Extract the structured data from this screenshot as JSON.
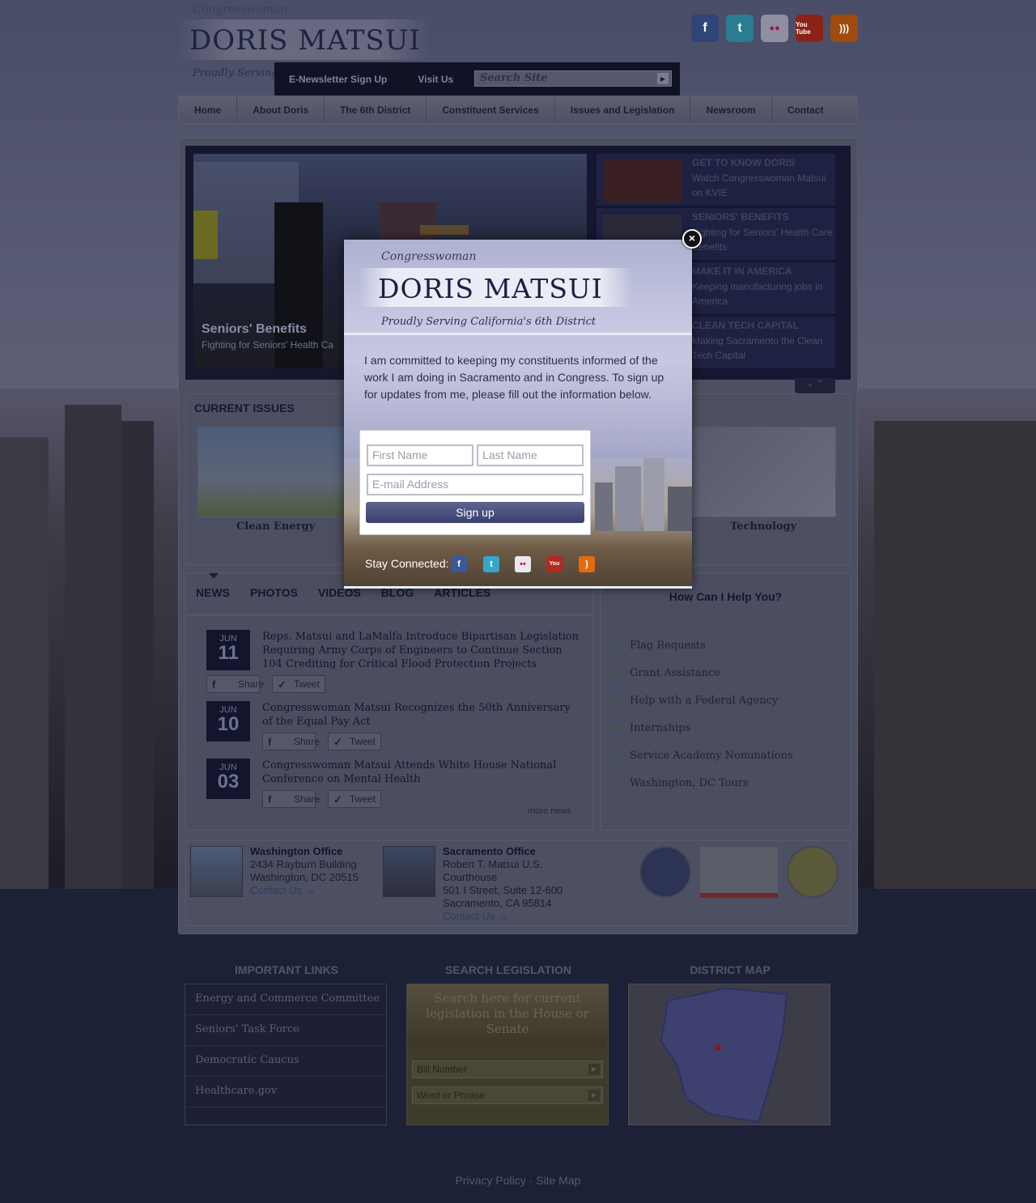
{
  "header": {
    "congresswoman": "Congresswoman",
    "name": "DORIS MATSUI",
    "tagline": "Proudly Serving California's 6th District",
    "socials": [
      {
        "icon": "facebook-icon",
        "glyph": "f",
        "color": "#3b5998"
      },
      {
        "icon": "twitter-icon",
        "glyph": "t",
        "color": "#33a7c9"
      },
      {
        "icon": "flickr-icon",
        "glyph": "●●",
        "color": "#d8d8e0"
      },
      {
        "icon": "youtube-icon",
        "glyph": "You Tube",
        "color": "#b32a1f"
      },
      {
        "icon": "rss-icon",
        "glyph": ")))",
        "color": "#e36b0f"
      }
    ]
  },
  "utility": {
    "newsletter": "E-Newsletter Sign Up",
    "visit": "Visit Us",
    "search_placeholder": "Search Site"
  },
  "nav": [
    "Home",
    "About Doris",
    "The 6th District",
    "Constituent Services",
    "Issues and Legislation",
    "Newsroom",
    "Contact"
  ],
  "slider": {
    "title": "Seniors' Benefits",
    "subtitle": "Fighting for Seniors' Health Ca",
    "thumbs": [
      {
        "title": "GET TO KNOW DORIS",
        "text": "Watch Congresswoman Matsui on KVIE"
      },
      {
        "title": "SENIORS' BENEFITS",
        "text": "Fighting for Seniors' Health Care Benefits"
      },
      {
        "title": "MAKE IT IN AMERICA",
        "text": "Keeping manufacturing jobs in America"
      },
      {
        "title": "CLEAN TECH CAPITAL",
        "text": "Making Sacramento the Clean Tech Capital"
      }
    ]
  },
  "current_issues": {
    "title": "CURRENT ISSUES",
    "items": [
      "Clean Energy",
      "Technology"
    ]
  },
  "news": {
    "tabs": [
      "NEWS",
      "PHOTOS",
      "VIDEOS",
      "BLOG",
      "ARTICLES"
    ],
    "share_label": "Share",
    "tweet_label": "Tweet",
    "items": [
      {
        "month": "JUN",
        "day": "11",
        "headline": "Reps. Matsui and LaMalfa Introduce Bipartisan Legislation Requiring Army Corps of Engineers to Continue Section 104 Crediting for Critical Flood Protection Projects"
      },
      {
        "month": "JUN",
        "day": "10",
        "headline": "Congresswoman Matsui Recognizes the 50th Anniversary of the Equal Pay Act"
      },
      {
        "month": "JUN",
        "day": "03",
        "headline": "Congresswoman Matsui Attends White House National Conference on Mental Health"
      }
    ],
    "more": "more news"
  },
  "help": {
    "title": "How Can I Help You?",
    "items": [
      "Flag Requests",
      "Grant Assistance",
      "Help with a Federal Agency",
      "Internships",
      "Service Academy Nominations",
      "Washington, DC Tours"
    ]
  },
  "offices": [
    {
      "name": "Washington Office",
      "line1": "2434 Rayburn Building",
      "line2": "Washington, DC 20515",
      "contact": "Contact Us →"
    },
    {
      "name": "Sacramento Office",
      "line1": "Robert T. Matsui U.S.",
      "line2": "Courthouse",
      "line3": "501 I Street, Suite 12-600",
      "line4": "Sacramento, CA 95814",
      "contact": "Contact Us →"
    }
  ],
  "footer": {
    "important_links_title": "IMPORTANT LINKS",
    "important_links": [
      "Energy and Commerce Committee",
      "Seniors' Task Force",
      "Democratic Caucus",
      "Healthcare.gov"
    ],
    "search_leg_title": "SEARCH LEGISLATION",
    "search_leg_text": "Search here for current legislation in the House or Senate",
    "bill_number": "Bill Number",
    "word_phrase": "Word or Phrase",
    "district_map_title": "DISTRICT MAP",
    "privacy": "Privacy Policy",
    "sep": "·",
    "sitemap": "Site Map"
  },
  "modal": {
    "congresswoman": "Congresswoman",
    "name": "DORIS MATSUI",
    "tagline": "Proudly Serving California's 6th District",
    "body": "I am committed to keeping my constituents informed of the work I am doing in Sacramento and in Congress. To sign up for updates from me, please fill out the information below.",
    "first_name": "First Name",
    "last_name": "Last Name",
    "email": "E-mail Address",
    "signup": "Sign up",
    "stay_connected": "Stay Connected:"
  }
}
